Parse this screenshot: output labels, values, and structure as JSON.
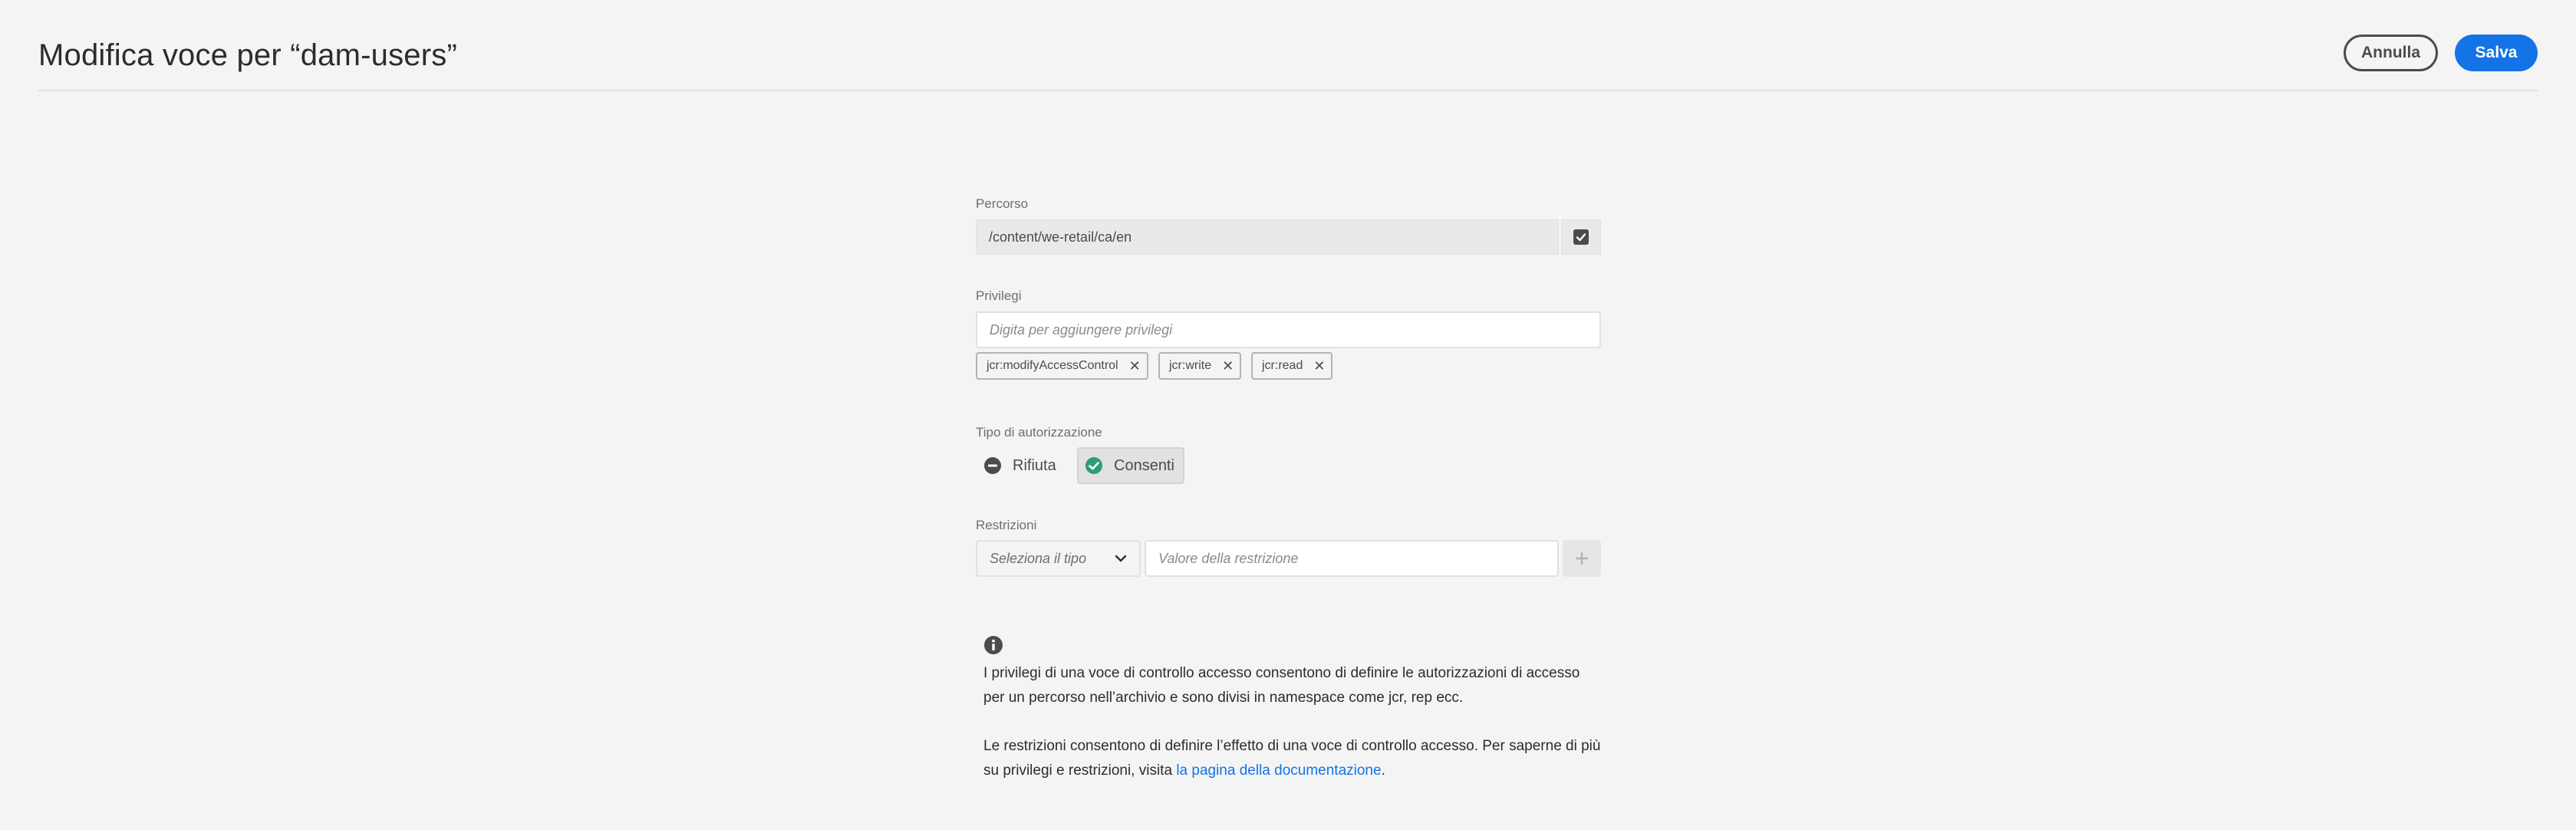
{
  "header": {
    "title": "Modifica voce per “dam-users”",
    "cancel_label": "Annulla",
    "save_label": "Salva"
  },
  "path": {
    "label": "Percorso",
    "value": "/content/we-retail/ca/en",
    "checked": true
  },
  "privileges": {
    "label": "Privilegi",
    "placeholder": "Digita per aggiungere privilegi",
    "tags": [
      "jcr:modifyAccessControl",
      "jcr:write",
      "jcr:read"
    ]
  },
  "auth_type": {
    "label": "Tipo di autorizzazione",
    "deny_label": "Rifiuta",
    "allow_label": "Consenti",
    "selected": "Consenti"
  },
  "restrictions": {
    "label": "Restrizioni",
    "type_placeholder": "Seleziona il tipo",
    "value_placeholder": "Valore della restrizione"
  },
  "info": {
    "paragraph1": "I privilegi di una voce di controllo accesso consentono di definire le autorizzazioni di accesso per un percorso nell’archivio e sono divisi in namespace come jcr, rep ecc.",
    "paragraph2": "Le restrizioni consentono di definire l’effetto di una voce di controllo accesso. Per saperne di più su privilegi e restrizioni, visita ",
    "link_text": "la pagina della documentazione",
    "link_suffix": "."
  },
  "colors": {
    "accent": "#1473e6",
    "allow_green": "#2d9d78",
    "deny_gray": "#4b4b4b"
  }
}
